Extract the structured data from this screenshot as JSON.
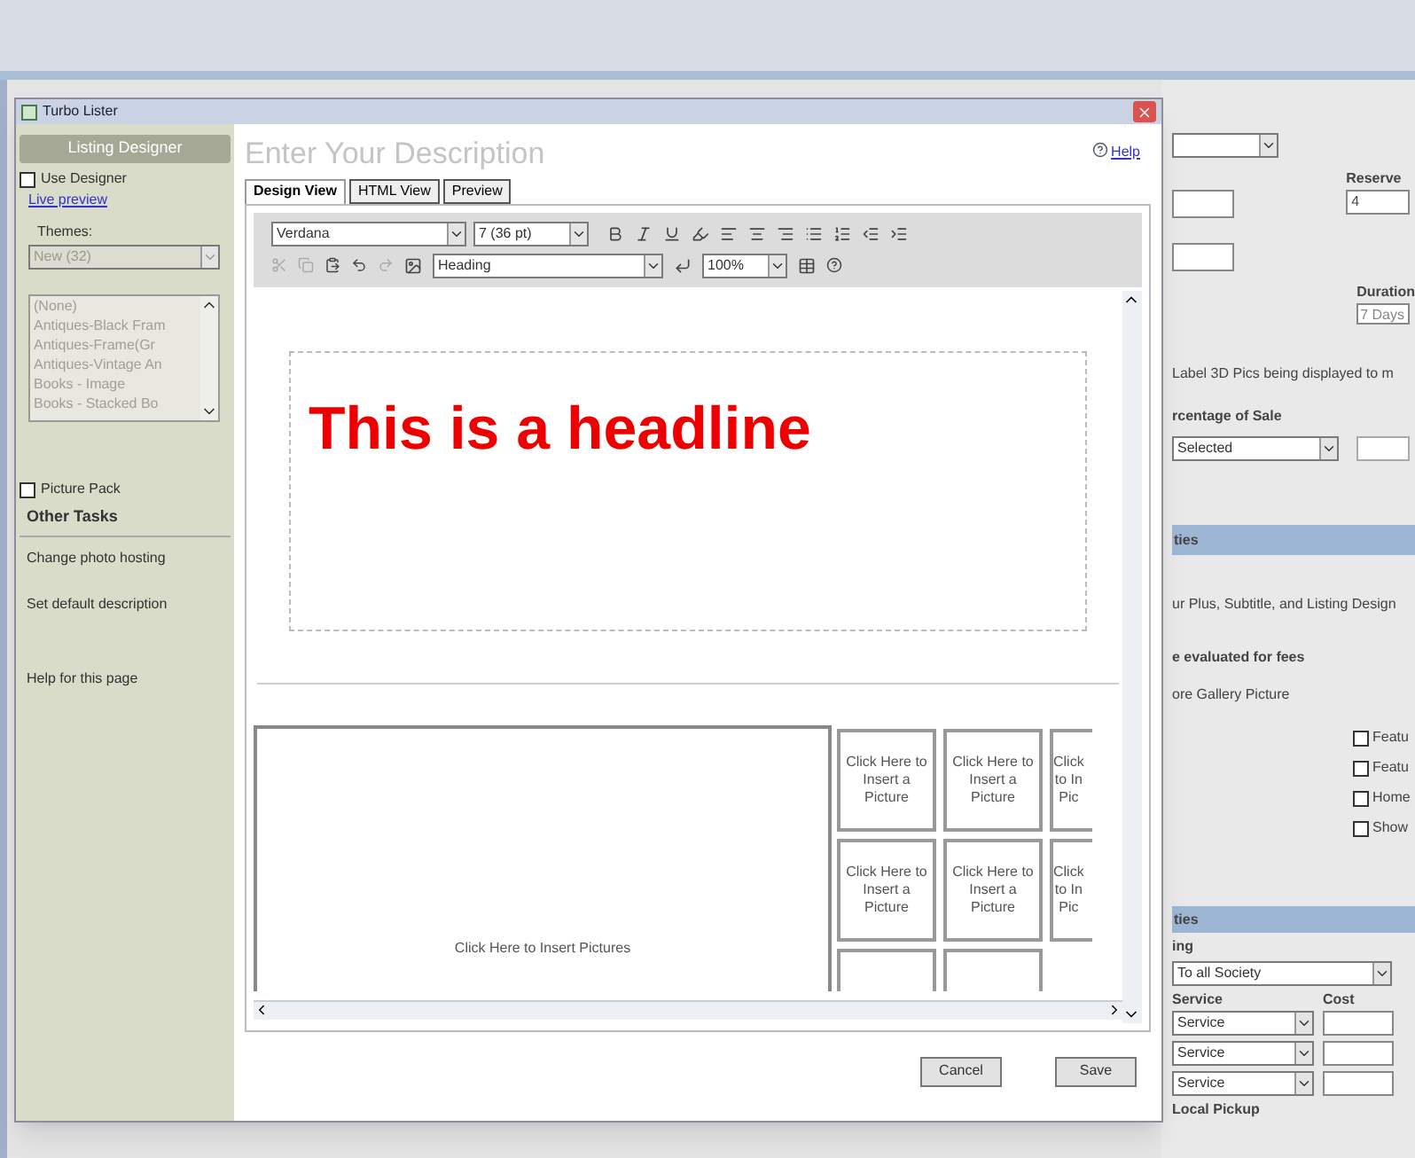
{
  "window": {
    "title": "Turbo Lister"
  },
  "sidebar": {
    "header": "Listing Designer",
    "use_designer": {
      "label": "Use Designer",
      "checked": false
    },
    "link": "Live preview",
    "themes_label": "Themes:",
    "themes_select": {
      "value": "New (32)",
      "disabled": true
    },
    "themes_list": [
      {
        "label": "(None)"
      },
      {
        "label": "Antiques-Black Fram"
      },
      {
        "label": "Antiques-Frame(Gr"
      },
      {
        "label": "Antiques-Vintage An"
      },
      {
        "label": "Books - Image"
      },
      {
        "label": "Books - Stacked Bo"
      }
    ],
    "picture_pack": {
      "label": "Picture Pack",
      "checked": false
    },
    "other_tasks_title": "Other Tasks",
    "tasks": [
      {
        "label": "Change photo hosting"
      },
      {
        "label": "Set default description"
      },
      {
        "label": "Help for this page"
      }
    ]
  },
  "heading": "Enter Your Description",
  "help": "Help",
  "tabs": [
    {
      "label": "Design View",
      "selected": true
    },
    {
      "label": "HTML View",
      "selected": false
    },
    {
      "label": "Preview",
      "selected": false
    }
  ],
  "toolbar": {
    "font": "Verdana",
    "size": "7 (36 pt)",
    "style": "Heading",
    "zoom": "100%"
  },
  "editor": {
    "headline": "This is a headline",
    "main_picture": "Click Here to Insert Pictures",
    "thumbnails": [
      [
        "Click Here to Insert a Picture",
        "Click Here to Insert a Picture",
        "Click\nto In\nPic"
      ],
      [
        "Click Here to Insert a Picture",
        "Click Here to Insert a Picture",
        "Click\nto In\nPic"
      ]
    ]
  },
  "buttons": [
    "Cancel",
    "Save"
  ],
  "background": {
    "reserve_label": "Reserve",
    "reserve_value": "4",
    "duration_label": "Duration",
    "duration_value": "7 Days",
    "note": "Label 3D Pics being displayed to m",
    "percentage_label": "rcentage of Sale",
    "percentage_value": "Selected",
    "section_1": "ties",
    "upgrade_note": "ur Plus, Subtitle, and Listing Design",
    "fees_label": "e evaluated for fees",
    "gallery_note": "ore Gallery Picture",
    "options": [
      {
        "label": "Featu",
        "checked": false
      },
      {
        "label": "Featu",
        "checked": false
      },
      {
        "label": "Home",
        "checked": false
      },
      {
        "label": "Show",
        "checked": false
      }
    ],
    "section_2": "ties",
    "shipping_label": "ing",
    "region_value": "To all Society",
    "service_label": "Service",
    "cost_label": "Cost",
    "services": [
      {
        "service": "Service"
      },
      {
        "service": "Service"
      },
      {
        "service": "Service"
      }
    ],
    "local_pickup": "Local Pickup"
  }
}
